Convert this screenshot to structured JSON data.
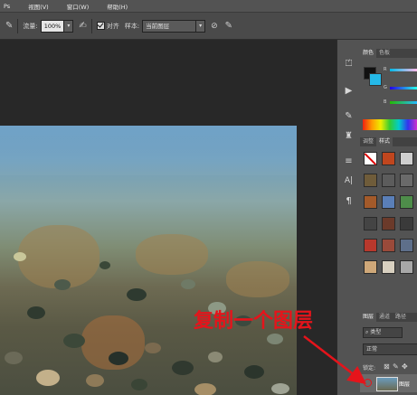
{
  "menubar": {
    "items": [
      "Ps",
      "视图(V)",
      "窗口(W)",
      "帮助(H)"
    ]
  },
  "options": {
    "opacity_label": "流量:",
    "opacity_value": "100%",
    "align_label": "对齐",
    "sample_label": "样本:",
    "sample_value": "当前图层"
  },
  "panels": {
    "color_tabs": [
      "颜色",
      "色板"
    ],
    "color_labels": [
      "R",
      "G",
      "B"
    ],
    "style_tabs": [
      "调整",
      "样式"
    ],
    "layer_tabs": [
      "图层",
      "通道",
      "路径"
    ],
    "layer_filter": "类型",
    "blend_mode": "正常",
    "lock_label": "锁定:",
    "layer_name": "图层"
  },
  "annotation": {
    "text": "复制一个图层"
  },
  "colors": {
    "foreground": "#111111",
    "background": "#25b9e8",
    "annotation": "#e5141b"
  }
}
